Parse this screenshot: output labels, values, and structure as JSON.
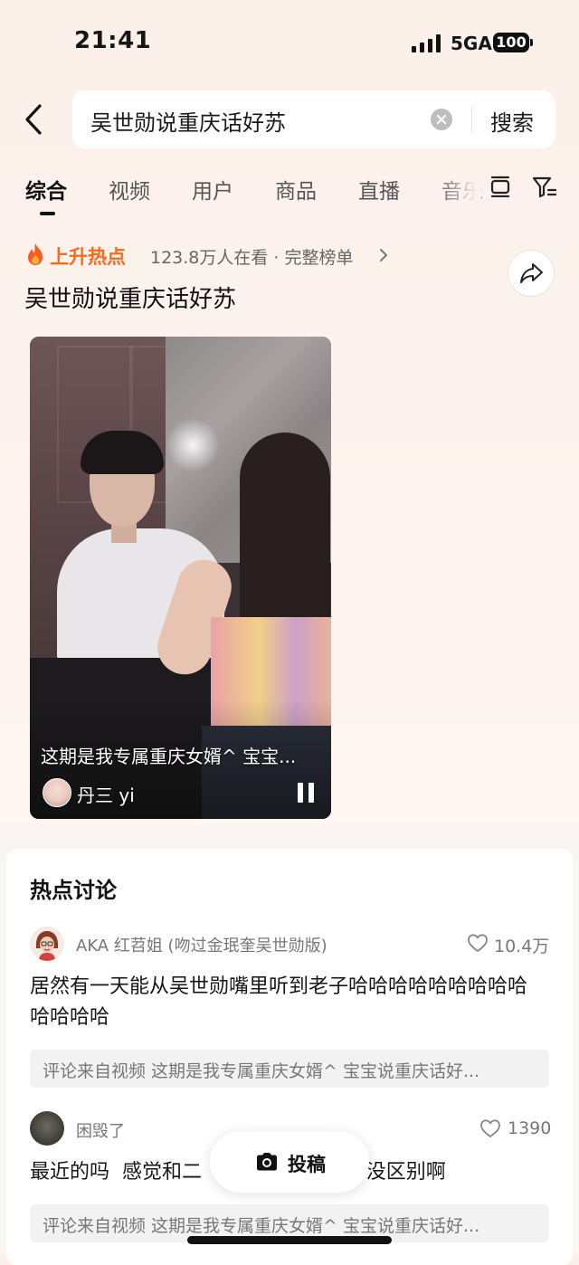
{
  "status_bar": {
    "time": "21:41",
    "network": "5GA",
    "battery": "100"
  },
  "search": {
    "query": "吴世勋说重庆话好苏",
    "button_label": "搜索"
  },
  "tabs": [
    {
      "label": "综合",
      "active": true
    },
    {
      "label": "视频",
      "active": false
    },
    {
      "label": "用户",
      "active": false
    },
    {
      "label": "商品",
      "active": false
    },
    {
      "label": "直播",
      "active": false
    },
    {
      "label": "音乐",
      "active": false
    }
  ],
  "hot_topic": {
    "badge": "上升热点",
    "stats": "123.8万人在看 · 完整榜单",
    "title": "吴世勋说重庆话好苏"
  },
  "video": {
    "caption": "这期是我专属重庆女婿^ 宝宝...",
    "author": "丹三 yi"
  },
  "discussion": {
    "title": "热点讨论",
    "comments": [
      {
        "user": "AKA 红苕姐 (吻过金珉奎吴世勋版)",
        "likes": "10.4万",
        "text": "居然有一天能从吴世勋嘴里听到老子哈哈哈哈哈哈哈哈哈哈哈哈哈",
        "source": "评论来自视频  这期是我专属重庆女婿^ 宝宝说重庆话好..."
      },
      {
        "user": "困毁了",
        "likes": "1390",
        "text": "最近的吗  感觉和二                          没区别啊",
        "source": "评论来自视频  这期是我专属重庆女婿^ 宝宝说重庆话好..."
      }
    ]
  },
  "post_button": {
    "label": "投稿"
  }
}
